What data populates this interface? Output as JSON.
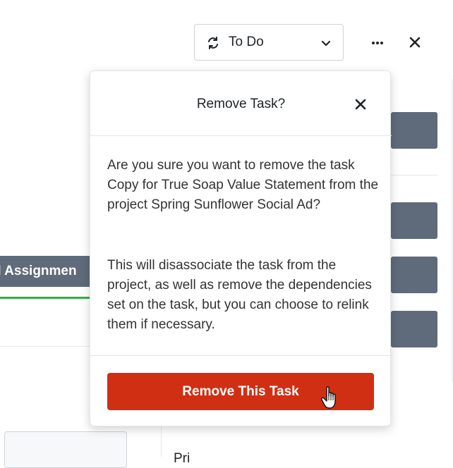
{
  "header": {
    "status": {
      "label": "To Do",
      "icon": "status-cycle-icon"
    },
    "more_icon": "ellipsis-icon",
    "close_icon": "close-icon"
  },
  "background": {
    "tab_label": "d Assignmen",
    "bottom_text": "Pri"
  },
  "dialog": {
    "title": "Remove Task?",
    "close_icon": "close-icon",
    "message": "Are you sure you want to remove the task Copy for True Soap Value Statement from the project Spring Sunflower Social Ad?",
    "detail": "This will disassociate the task from the project, as well as remove the dependencies set on the task, but you can choose to relink them if necessary.",
    "confirm_label": "Remove This Task"
  },
  "colors": {
    "danger": "#d12f14",
    "slate": "#5f6b7a",
    "active_tab": "#2fb344"
  }
}
